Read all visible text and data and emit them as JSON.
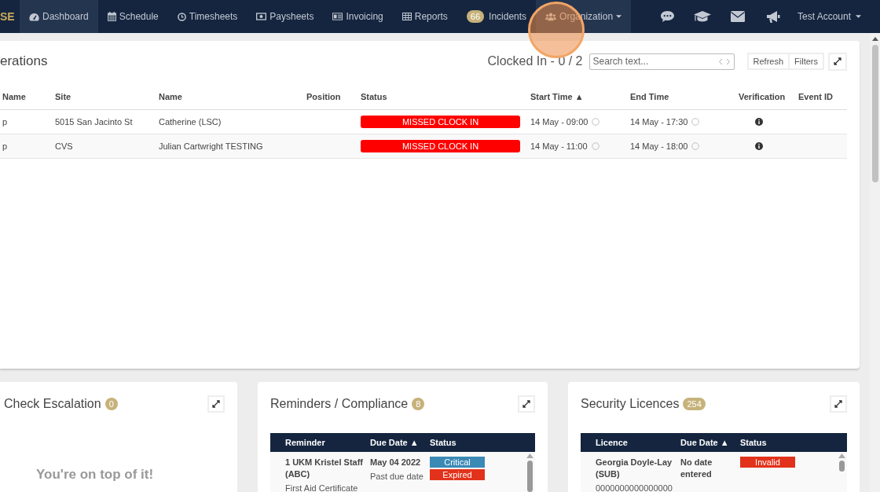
{
  "navbar": {
    "brand": "SE",
    "tabs": [
      {
        "label": "Dashboard",
        "selected": true
      },
      {
        "label": "Schedule",
        "selected": false
      },
      {
        "label": "Timesheets",
        "selected": false
      },
      {
        "label": "Paysheets",
        "selected": false
      },
      {
        "label": "Invoicing",
        "selected": false
      },
      {
        "label": "Reports",
        "selected": false
      },
      {
        "label": "Incidents",
        "badge": "66",
        "selected": false
      },
      {
        "label": "Organization",
        "selected": true
      }
    ],
    "account": "Test Account"
  },
  "operations": {
    "title": "erations",
    "clocked_in": "Clocked In - 0 / 2",
    "search": {
      "placeholder": "Search text..."
    },
    "buttons": [
      "Refresh",
      "Filters"
    ],
    "table": {
      "columns": [
        "Name",
        "Site",
        "Name",
        "Position",
        "Status",
        "Start Time ▲",
        "End Time",
        "Verification",
        "Event ID"
      ],
      "rows": [
        {
          "column_1": "p",
          "site": "5015 San Jacinto St",
          "name": "Catherine (LSC)",
          "status": "MISSED CLOCK IN",
          "start_time": "14 May - 09:00",
          "end_time": "14 May - 17:30"
        },
        {
          "column_1": "p",
          "site": "CVS",
          "name": "Julian Cartwright TESTING",
          "status": "MISSED CLOCK IN",
          "start_time": "14 May - 11:00",
          "end_time": "14 May - 18:00"
        }
      ]
    }
  },
  "cards": [
    {
      "kind": "empty",
      "title": "Check Escalation",
      "count": "0",
      "message": "You're on top of it!"
    },
    {
      "kind": "table",
      "title": "Reminders / Compliance",
      "count": "8",
      "columns": [
        "Reminder",
        "Due Date ▲",
        "Status"
      ],
      "rows": [
        {
          "title": "1 UKM Kristel Staff (ABC)",
          "detail": "First Aid Certificate",
          "due": "May 04 2022",
          "due_note": "Past due date",
          "statuses": [
            {
              "label": "Critical",
              "color": "#3b8ab6"
            },
            {
              "label": "Expired",
              "color": "#e2321b"
            }
          ]
        }
      ]
    },
    {
      "kind": "table",
      "title": "Security Licences",
      "count": "254",
      "columns": [
        "Licence",
        "Due Date ▲",
        "Status"
      ],
      "rows": [
        {
          "title": "Georgia Doyle-Lay (SUB)",
          "detail": "0000000000000000",
          "due": "No date entered",
          "statuses": [
            {
              "label": "Invalid",
              "color": "#e2321b"
            }
          ]
        }
      ]
    }
  ]
}
